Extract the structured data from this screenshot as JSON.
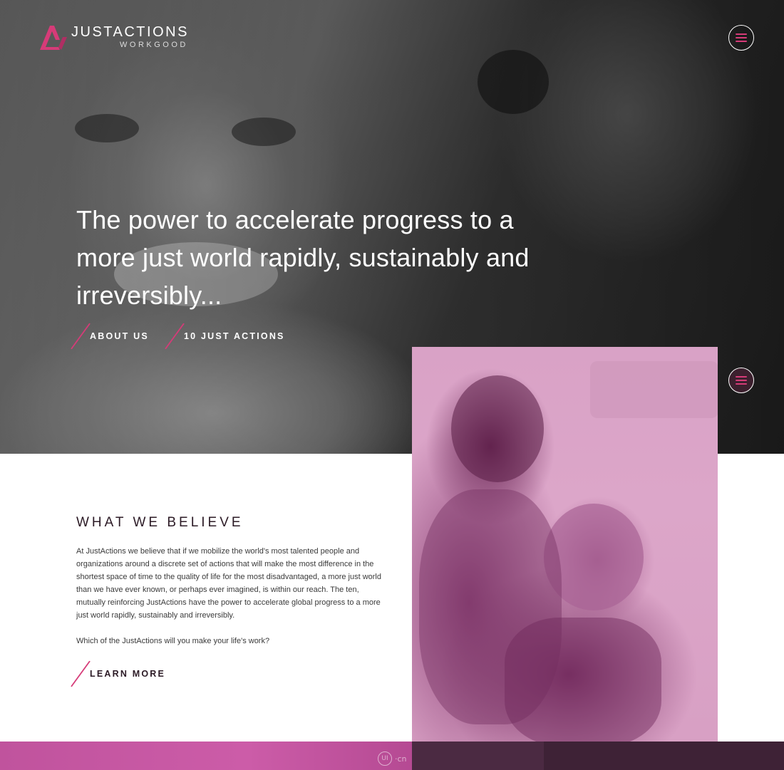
{
  "brand": {
    "title": "JUSTACTIONS",
    "subtitle": "WORKGOOD",
    "accent_color": "#d63b78"
  },
  "hero": {
    "headline": "The power to accelerate progress to a more just world rapidly, sustainably and irreversibly...",
    "links": [
      {
        "label": "ABOUT US"
      },
      {
        "label": "10 JUST ACTIONS"
      }
    ]
  },
  "believe": {
    "title": "WHAT WE BELIEVE",
    "body": "At JustActions we believe that if we mobilize the world's most talented people and organizations around a discrete set of actions that will make the most difference in the shortest space of time to the quality of life for the most disadvantaged, a more just world than we have ever known, or perhaps ever imagined, is within our reach. The ten, mutually reinforcing JustActions have the power to accelerate global progress to a more just world rapidly, sustainably and irreversibly.",
    "question": "Which of the JustActions will you make your life's work?",
    "cta": "LEARN MORE"
  },
  "icons": {
    "menu": "hamburger-icon",
    "logo": "logo-mark-icon"
  },
  "watermark": {
    "mark": "UI",
    "text": "·cn"
  }
}
